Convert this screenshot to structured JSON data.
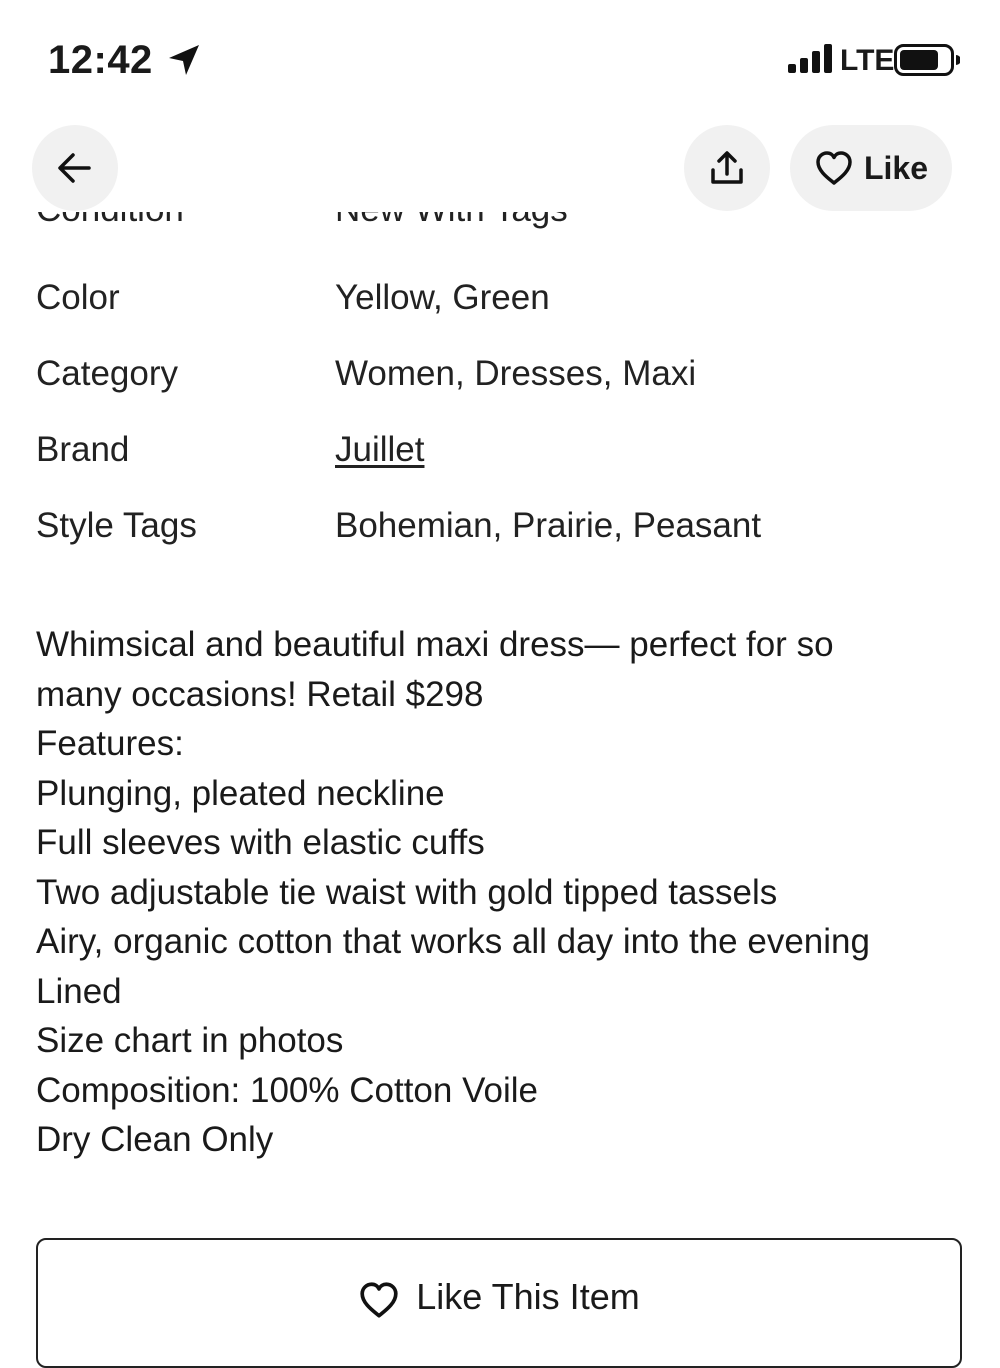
{
  "status_bar": {
    "time": "12:42",
    "network": "LTE"
  },
  "header": {
    "like_label": "Like"
  },
  "clipped_row": {
    "key": "Condition",
    "value": "New With Tags"
  },
  "attributes": [
    {
      "key": "Color",
      "value": "Yellow, Green"
    },
    {
      "key": "Category",
      "value": "Women, Dresses, Maxi"
    },
    {
      "key": "Brand",
      "value": "Juillet"
    },
    {
      "key": "Style Tags",
      "value": "Bohemian, Prairie, Peasant"
    }
  ],
  "description": [
    "Whimsical and beautiful maxi dress— perfect for so",
    "many occasions! Retail $298",
    "Features:",
    "Plunging, pleated neckline",
    "Full sleeves with elastic cuffs",
    "Two adjustable tie waist with gold tipped tassels",
    "Airy, organic cotton that works all day into the evening",
    "Lined",
    "Size chart in photos",
    "Composition: 100% Cotton Voile",
    "Dry Clean Only"
  ],
  "like_item_button": {
    "label": "Like This Item"
  }
}
